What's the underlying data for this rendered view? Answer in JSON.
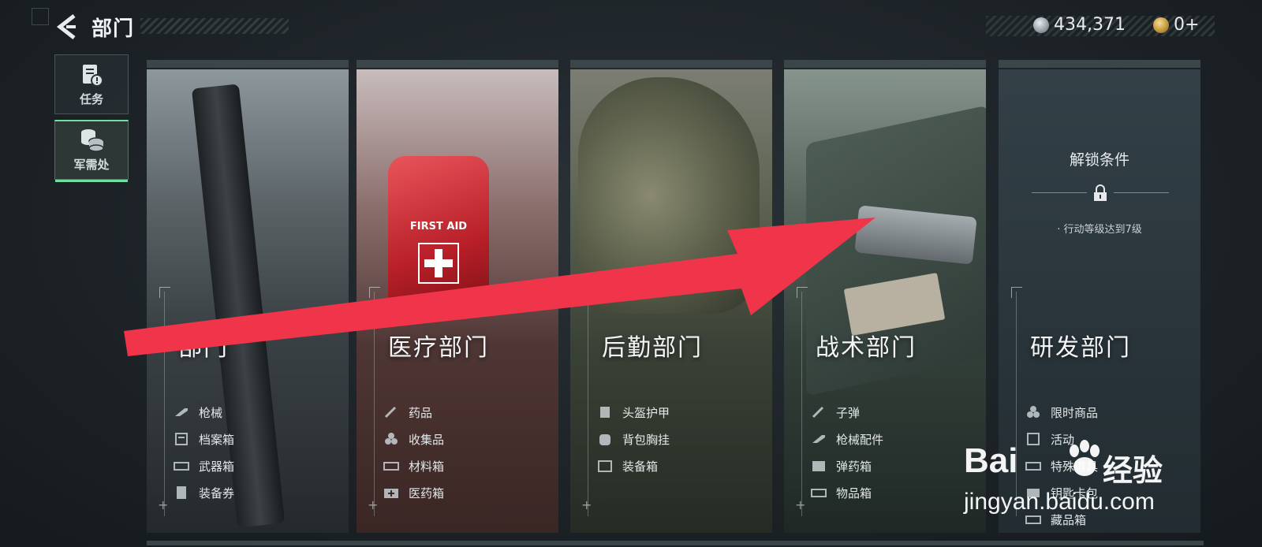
{
  "header": {
    "title": "部门"
  },
  "currency": [
    {
      "amount": "434,371",
      "icon": "silver-coin-icon"
    },
    {
      "amount": "0+",
      "icon": "gold-coin-icon"
    }
  ],
  "side_nav": [
    {
      "label": "任务",
      "icon": "task-clipboard-icon"
    },
    {
      "label": "军需处",
      "icon": "coin-stack-icon",
      "active": true
    }
  ],
  "cards": [
    {
      "title": "部门",
      "items": [
        "枪械",
        "档案箱",
        "武器箱",
        "装备券"
      ],
      "locked": false
    },
    {
      "title": "医疗部门",
      "items": [
        "药品",
        "收集品",
        "材料箱",
        "医药箱"
      ],
      "locked": false,
      "prop_text": "FIRST AID"
    },
    {
      "title": "后勤部门",
      "items": [
        "头盔护甲",
        "背包胸挂",
        "装备箱"
      ],
      "locked": false
    },
    {
      "title": "战术部门",
      "items": [
        "子弹",
        "枪械配件",
        "弹药箱",
        "物品箱"
      ],
      "locked": false
    },
    {
      "title": "研发部门",
      "items": [
        "限时商品",
        "活动",
        "特殊道具",
        "钥匙卡包",
        "藏品箱"
      ],
      "locked": true,
      "unlock": {
        "title": "解锁条件",
        "condition": "· 行动等级达到7级"
      }
    }
  ],
  "overlay": {
    "arrow_color": "#f0344a"
  },
  "watermark": {
    "brand": "Bai",
    "brand_cn": "经验",
    "url": "jingyan.baidu.com"
  },
  "colors": {
    "accent": "#6fe0a0",
    "arrow": "#f0344a"
  }
}
